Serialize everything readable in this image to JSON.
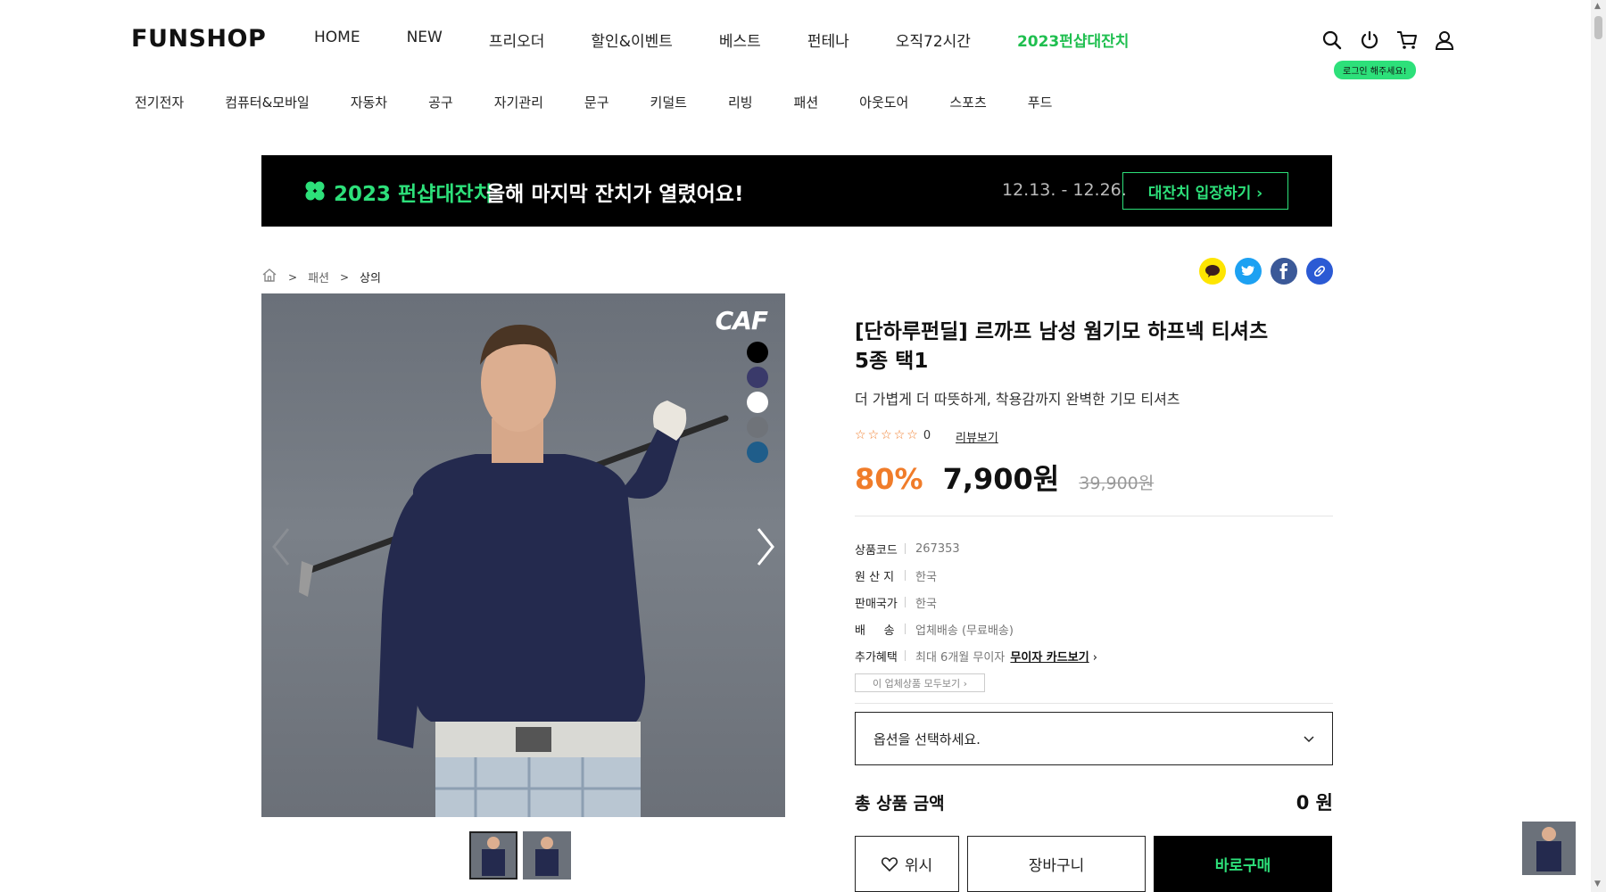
{
  "header": {
    "logo": "FUNSHOP",
    "gnb": [
      "HOME",
      "NEW",
      "프리오더",
      "할인&이벤트",
      "베스트",
      "펀테나",
      "오직72시간",
      "2023펀샵대잔치"
    ],
    "util_icons": [
      "search-icon",
      "power-icon",
      "cart-icon",
      "user-icon"
    ],
    "login_badge": "로그인 해주세요!",
    "categories": [
      "전기전자",
      "컴퓨터&모바일",
      "자동차",
      "공구",
      "자기관리",
      "문구",
      "키덜트",
      "리빙",
      "패션",
      "아웃도어",
      "스포츠",
      "푸드"
    ]
  },
  "banner": {
    "title": "2023 펀샵대잔치",
    "subtitle": "올해 마지막 잔치가 열렸어요!",
    "date": "12.13. - 12.26.",
    "button": "대잔치 입장하기 ›"
  },
  "breadcrumb": [
    "패션",
    "상의"
  ],
  "share_icons": [
    "kakao-icon",
    "twitter-icon",
    "facebook-icon",
    "link-icon"
  ],
  "image": {
    "brand_mark": "CAF",
    "swatches": [
      "#000000",
      "#3a3a6a",
      "#ffffff",
      "#6f7379",
      "#1f5d8a"
    ]
  },
  "product": {
    "title": "[단하루펀딜] 르까프 남성 웜기모 하프넥 티셔츠 5종 택1",
    "description": "더 가볍게 더 따뜻하게, 착용감까지 완벽한 기모 티셔츠",
    "rating_count": "0",
    "review_link": "리뷰보기",
    "discount": "80%",
    "price": "7,900원",
    "original_price": "39,900원",
    "info": [
      {
        "key": "상품코드",
        "value": "267353"
      },
      {
        "key": "원 산 지",
        "value": "한국"
      },
      {
        "key": "판매국가",
        "value": "한국"
      },
      {
        "key": "배     송",
        "value": "업체배송 (무료배송)"
      },
      {
        "key": "추가혜택",
        "value": "최대 6개월 무이자",
        "link": "무이자 카드보기"
      }
    ],
    "all_products_button": "이 업체상품 모두보기 ›",
    "option_placeholder": "옵션을 선택하세요.",
    "total_label": "총 상품 금액",
    "total_amount": "0 원",
    "wish_button": "위시",
    "cart_button": "장바구니",
    "buy_button": "바로구매"
  },
  "colors": {
    "accent_green": "#2de07a",
    "discount_orange": "#f07c2a"
  }
}
